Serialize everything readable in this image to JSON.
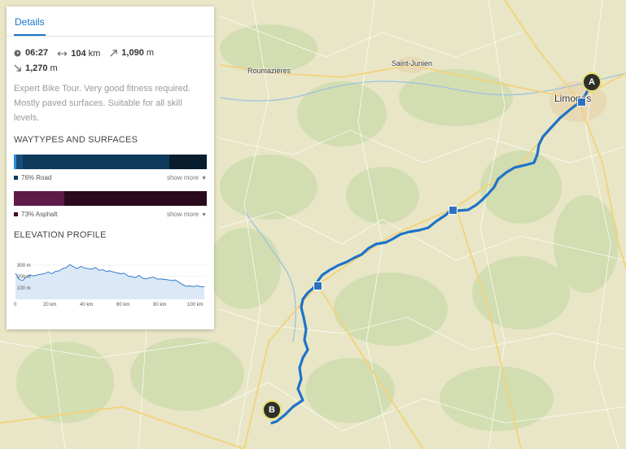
{
  "tab": {
    "label": "Details"
  },
  "stats": {
    "duration": "06:27",
    "distance_value": "104",
    "distance_unit": "km",
    "uphill_value": "1,090",
    "uphill_unit": "m",
    "downhill_value": "1,270",
    "downhill_unit": "m"
  },
  "description": "Expert Bike Tour. Very good fitness required. Mostly paved surfaces. Suitable for all skill levels.",
  "waytypes": {
    "title": "WAYTYPES AND SURFACES",
    "road_legend": "76% Road",
    "surface_legend": "73% Asphalt",
    "show_more": "show more",
    "road_color": "#0e3a5c",
    "asphalt_color": "#3b0d27"
  },
  "elevation": {
    "title": "ELEVATION PROFILE",
    "y_ticks": [
      "300 m",
      "200 m",
      "100 m"
    ],
    "x_ticks": [
      "0",
      "20 km",
      "40 km",
      "60 km",
      "80 km",
      "100 km"
    ],
    "profile": [
      [
        0,
        230
      ],
      [
        2,
        175
      ],
      [
        4,
        165
      ],
      [
        6,
        200
      ],
      [
        8,
        215
      ],
      [
        10,
        205
      ],
      [
        12,
        215
      ],
      [
        14,
        220
      ],
      [
        16,
        225
      ],
      [
        18,
        240
      ],
      [
        20,
        225
      ],
      [
        22,
        245
      ],
      [
        24,
        250
      ],
      [
        26,
        270
      ],
      [
        28,
        280
      ],
      [
        30,
        305
      ],
      [
        32,
        285
      ],
      [
        34,
        270
      ],
      [
        36,
        290
      ],
      [
        38,
        275
      ],
      [
        40,
        270
      ],
      [
        42,
        265
      ],
      [
        44,
        280
      ],
      [
        46,
        255
      ],
      [
        48,
        260
      ],
      [
        50,
        245
      ],
      [
        52,
        250
      ],
      [
        54,
        240
      ],
      [
        56,
        232
      ],
      [
        58,
        225
      ],
      [
        60,
        230
      ],
      [
        62,
        205
      ],
      [
        64,
        200
      ],
      [
        66,
        190
      ],
      [
        68,
        210
      ],
      [
        70,
        185
      ],
      [
        72,
        180
      ],
      [
        74,
        190
      ],
      [
        76,
        195
      ],
      [
        78,
        178
      ],
      [
        80,
        180
      ],
      [
        82,
        175
      ],
      [
        84,
        172
      ],
      [
        86,
        165
      ],
      [
        88,
        170
      ],
      [
        90,
        150
      ],
      [
        92,
        130
      ],
      [
        94,
        115
      ],
      [
        96,
        118
      ],
      [
        98,
        112
      ],
      [
        100,
        120
      ],
      [
        102,
        110
      ],
      [
        104,
        112
      ]
    ]
  },
  "map": {
    "labels": [
      "Roumazières",
      "Saint-Junien",
      "Limoges"
    ],
    "marker_start": "A",
    "marker_end": "B"
  }
}
